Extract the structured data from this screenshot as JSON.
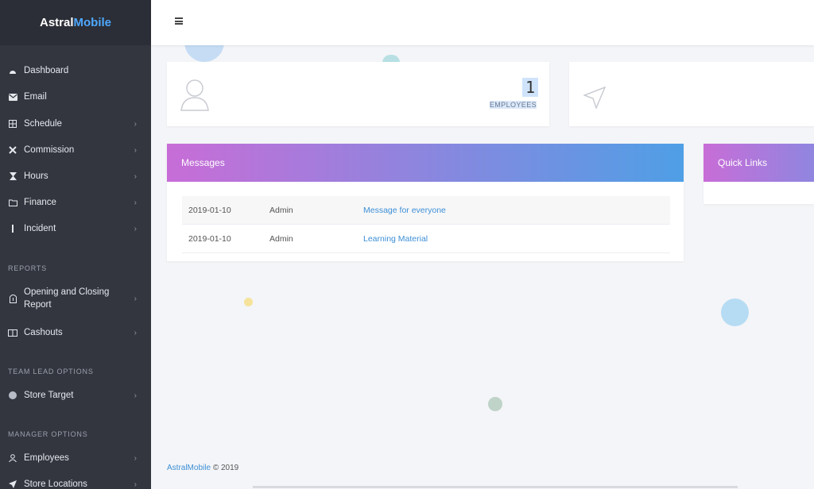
{
  "brand": {
    "part1": "Astral",
    "part2": "Mobile"
  },
  "sidebar": {
    "items": [
      {
        "label": "Dashboard",
        "icon": "dashboard-icon",
        "chevron": false
      },
      {
        "label": "Email",
        "icon": "email-icon",
        "chevron": false
      },
      {
        "label": "Schedule",
        "icon": "schedule-icon",
        "chevron": true
      },
      {
        "label": "Commission",
        "icon": "commission-icon",
        "chevron": true
      },
      {
        "label": "Hours",
        "icon": "hourglass-icon",
        "chevron": true
      },
      {
        "label": "Finance",
        "icon": "folder-icon",
        "chevron": true
      },
      {
        "label": "Incident",
        "icon": "incident-icon",
        "chevron": true
      }
    ],
    "reports_heading": "REPORTS",
    "reports": [
      {
        "label": "Opening and Closing Report",
        "icon": "report-icon",
        "chevron": true
      },
      {
        "label": "Cashouts",
        "icon": "cashouts-icon",
        "chevron": true
      }
    ],
    "team_lead_heading": "TEAM LEAD OPTIONS",
    "team_lead": [
      {
        "label": "Store Target",
        "icon": "target-icon",
        "chevron": true
      }
    ],
    "manager_heading": "MANAGER OPTIONS",
    "manager": [
      {
        "label": "Employees",
        "icon": "employees-icon",
        "chevron": true
      },
      {
        "label": "Store Locations",
        "icon": "location-icon",
        "chevron": true
      }
    ],
    "chevron_glyph": "›"
  },
  "stats": {
    "employees_count": "1",
    "employees_label": "EMPLOYEES"
  },
  "messages": {
    "title": "Messages",
    "rows": [
      {
        "date": "2019-01-10",
        "user": "Admin",
        "subject": "Message for everyone"
      },
      {
        "date": "2019-01-10",
        "user": "Admin",
        "subject": "Learning Material"
      }
    ]
  },
  "quick_links": {
    "title": "Quick Links"
  },
  "footer": {
    "brand": "AstralMobile",
    "copyright": "© 2019"
  },
  "colors": {
    "sidebar_bg": "#33363f",
    "accent_blue": "#4fa8ff",
    "panel_gradient_start": "#c86dd7",
    "panel_gradient_end": "#4f9fe6",
    "link_blue": "#3d8fd6"
  }
}
